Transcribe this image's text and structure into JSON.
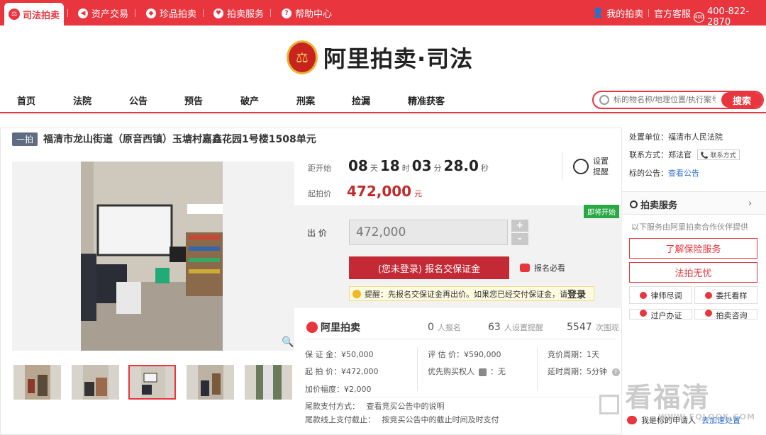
{
  "topbar": {
    "active_tab": "司法拍卖",
    "nav": [
      "资产交易",
      "珍品拍卖",
      "拍卖服务",
      "帮助中心"
    ],
    "my_auction": "我的拍卖",
    "service": "官方客服",
    "phone": "400-822-2870"
  },
  "logo": {
    "text": "阿里拍卖·司法"
  },
  "mainnav": [
    "首页",
    "法院",
    "公告",
    "预告",
    "破产",
    "刑案",
    "捡漏",
    "精准获客"
  ],
  "search": {
    "placeholder": "标的物名称/地理位置/执行案号",
    "button": "搜索"
  },
  "item": {
    "badge": "一拍",
    "title": "福清市龙山街道（原音西镇）玉塘村嘉鑫花园1号楼1508单元"
  },
  "countdown": {
    "label": "距开始",
    "days": "08",
    "days_unit": "天",
    "hours": "18",
    "hours_unit": "时",
    "minutes": "03",
    "minutes_unit": "分",
    "seconds": "28.0",
    "seconds_unit": "秒"
  },
  "remind": {
    "line1": "设置",
    "line2": "提醒"
  },
  "start_price": {
    "label": "起拍价",
    "value": "472,000",
    "unit": "元"
  },
  "bid": {
    "soon_badge": "即将开始",
    "label": "出 价",
    "value": "472,000",
    "plus": "+",
    "minus": "-",
    "signup": "(您未登录) 报名交保证金",
    "must_read": "报名必看",
    "tip": "提醒：先报名交保证金再出价。如果您已经交付保证金，请",
    "tip_login": "登录"
  },
  "stats": {
    "brand": "阿里拍卖",
    "signups": "0",
    "signups_label": "人报名",
    "reminders": "63",
    "reminders_label": "人设置提醒",
    "views": "5547",
    "views_label": "次围观"
  },
  "info": {
    "deposit": "保 证 金：¥50,000",
    "start": "起 拍 价：¥472,000",
    "increment": "加价幅度：¥2,000",
    "appraisal": "评 估 价：¥590,000",
    "priority": "优先购买权人",
    "priority_value": "：无",
    "cycle": "竞价周期：1天",
    "delay": "延时周期：5分钟",
    "final_pay": "尾款支付方式：",
    "final_pay_value": "查看竞买公告中的说明",
    "deadline": "尾款线上支付截止：",
    "deadline_value": "按竞买公告中的截止时间及时支付"
  },
  "side": {
    "unit_label": "处置单位：",
    "unit": "福清市人民法院",
    "contact_label": "联系方式：",
    "contact": "郑法官",
    "contact_btn": "联系方式",
    "notice_label": "标的公告：",
    "notice_link": "查看公告",
    "svc_title": "拍卖服务",
    "svc_note": "以下服务由阿里拍卖合作伙伴提供",
    "btn1": "了解保险服务",
    "btn2": "法拍无忧",
    "small1": "律师尽调",
    "small2": "委托看样",
    "small3": "过户办证",
    "small4": "拍卖咨询",
    "applicant": "我是标的申请人",
    "applicant_link": "去加速处置"
  },
  "watermark": {
    "text": "看福清",
    "url": "WWW.FQLOOK.COM"
  }
}
